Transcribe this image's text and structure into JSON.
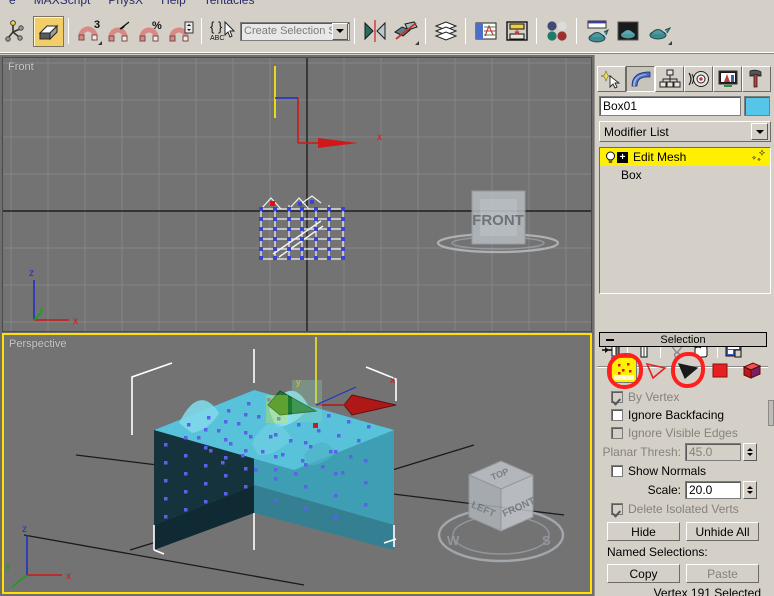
{
  "menubar": {
    "items": [
      "e",
      "MAXScript",
      "PhysX",
      "Help",
      "Tentacles"
    ]
  },
  "toolbar": {
    "buttons": [
      {
        "name": "select-and-manipulate",
        "label": "Select and Manipulate"
      },
      {
        "name": "snaps-toggle",
        "label": "Snaps Toggle",
        "active": true
      },
      {
        "name": "snap-3",
        "label": "3D Snap Toggle"
      },
      {
        "name": "angle-snap-toggle",
        "label": "Angle Snap Toggle"
      },
      {
        "name": "percent-snap-toggle",
        "label": "Percent Snap Toggle"
      },
      {
        "name": "spinner-snap-toggle",
        "label": "Spinner Snap Toggle"
      },
      {
        "name": "edit-named-selection-sets",
        "label": "Edit Named Selection Sets"
      },
      {
        "name": "mirror",
        "label": "Mirror"
      },
      {
        "name": "align",
        "label": "Align"
      },
      {
        "name": "layer-manager",
        "label": "Layer Manager"
      },
      {
        "name": "curve-editor",
        "label": "Curve Editor"
      },
      {
        "name": "schematic-view",
        "label": "Schematic View"
      },
      {
        "name": "material-editor",
        "label": "Material Editor"
      },
      {
        "name": "render-setup",
        "label": "Render Setup"
      },
      {
        "name": "rendered-frame-window",
        "label": "Rendered Frame Window"
      },
      {
        "name": "render-production",
        "label": "Render Production"
      }
    ],
    "selection_set": {
      "placeholder": "Create Selection Set",
      "value": ""
    }
  },
  "viewports": [
    {
      "name": "front",
      "label": "Front",
      "active": false,
      "viewcube_face": "FRONT",
      "axis": [
        "Z",
        "X",
        "Y"
      ]
    },
    {
      "name": "perspective",
      "label": "Perspective",
      "active": true,
      "viewcube_faces": [
        "TOP",
        "LEFT",
        "FRONT"
      ],
      "compass": [
        "W",
        "S"
      ],
      "axis": [
        "Z",
        "X",
        "Y"
      ]
    }
  ],
  "command_panel": {
    "tabs": [
      {
        "name": "create",
        "label": "Create",
        "active": false
      },
      {
        "name": "modify",
        "label": "Modify",
        "active": true
      },
      {
        "name": "hierarchy",
        "label": "Hierarchy",
        "active": false
      },
      {
        "name": "motion",
        "label": "Motion",
        "active": false
      },
      {
        "name": "display",
        "label": "Display",
        "active": false
      },
      {
        "name": "utilities",
        "label": "Utilities",
        "active": false
      }
    ],
    "object_name": "Box01",
    "object_color": "#55c5e8",
    "modifier_list_label": "Modifier List",
    "stack": [
      {
        "name": "edit-mesh",
        "label": "Edit Mesh",
        "selected": true,
        "has_plus": true
      },
      {
        "name": "box",
        "label": "Box",
        "selected": false,
        "has_plus": false
      }
    ],
    "stack_tools": [
      {
        "name": "pin-stack",
        "label": "Pin Stack"
      },
      {
        "name": "show-end-result",
        "label": "Show end result on/off toggle"
      },
      {
        "name": "make-unique",
        "label": "Make unique"
      },
      {
        "name": "remove-modifier",
        "label": "Remove modifier from the stack"
      },
      {
        "name": "configure-modifier-sets",
        "label": "Configure Modifier Sets"
      }
    ],
    "selection_rollout": {
      "title": "Selection",
      "subobject_buttons": [
        {
          "name": "vertex",
          "label": "Vertex",
          "selected": true,
          "annotated": true
        },
        {
          "name": "edge",
          "label": "Edge",
          "selected": false,
          "annotated": false
        },
        {
          "name": "face",
          "label": "Face",
          "selected": false,
          "annotated": true
        },
        {
          "name": "polygon",
          "label": "Polygon",
          "selected": false,
          "annotated": false
        },
        {
          "name": "element",
          "label": "Element",
          "selected": false,
          "annotated": false
        }
      ],
      "checkboxes": [
        {
          "name": "by-vertex",
          "label": "By Vertex",
          "checked": true,
          "disabled": true
        },
        {
          "name": "ignore-backfacing",
          "label": "Ignore Backfacing",
          "checked": false,
          "disabled": false
        },
        {
          "name": "ignore-visible-edges",
          "label": "Ignore Visible Edges",
          "checked": false,
          "disabled": true
        },
        {
          "name": "show-normals",
          "label": "Show Normals",
          "checked": false,
          "disabled": false
        },
        {
          "name": "delete-isolated-verts",
          "label": "Delete Isolated Verts",
          "checked": true,
          "disabled": true
        }
      ],
      "planar_thresh": {
        "label": "Planar Thresh:",
        "value": "45.0",
        "disabled": true
      },
      "scale": {
        "label": "Scale:",
        "value": "20.0",
        "disabled": false
      },
      "hide_button": "Hide",
      "unhide_all_button": "Unhide All",
      "named_selections_label": "Named Selections:",
      "copy_button": "Copy",
      "paste_button": "Paste",
      "status": "Vertex 191 Selected"
    }
  },
  "colors": {
    "accent_yellow": "#ffef00",
    "annotation_red": "#ff1f1f",
    "active_viewport_border": "#ffe000",
    "object_teal": "#4fb8cc",
    "panel_bg": "#d4d0c8",
    "viewport_bg": "#737373"
  }
}
